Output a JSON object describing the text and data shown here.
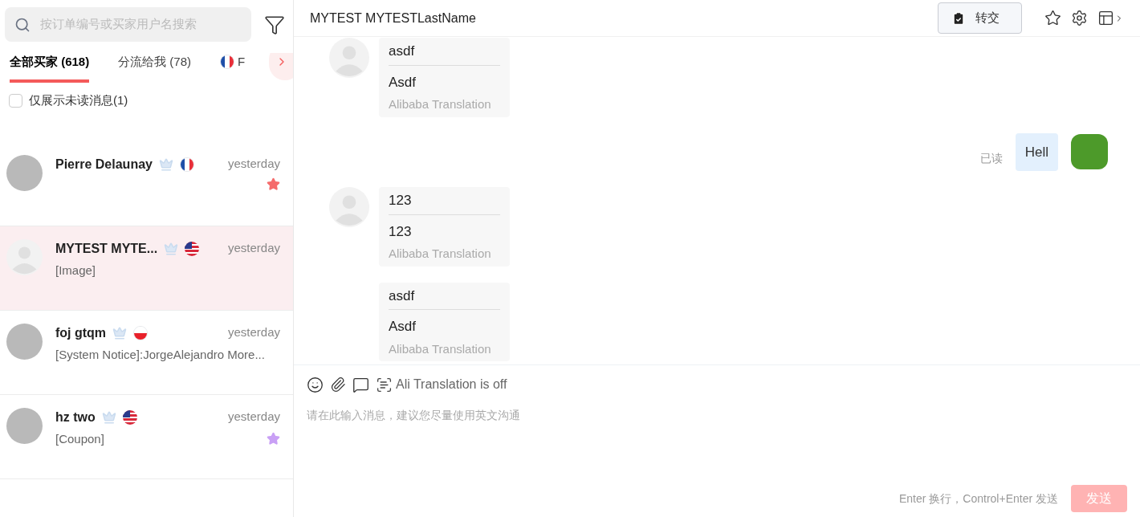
{
  "sidebar": {
    "search": {
      "placeholder": "按订单编号或买家用户名搜索"
    },
    "tabs": [
      {
        "label": "全部买家 (618)",
        "selected": true
      },
      {
        "label": "分流给我 (78)",
        "selected": false
      },
      {
        "label": "F",
        "selected": false,
        "flag": {
          "kind": "fr"
        }
      }
    ],
    "unread_filter": {
      "label": "仅展示未读消息(1)",
      "checked": false
    },
    "contacts": [
      {
        "name": "Pierre Delaunay",
        "has_photo": true,
        "flag": {
          "kind": "fr"
        },
        "time": "yesterday",
        "starred": true,
        "color": "#f56c6c",
        "selected": false
      },
      {
        "name": "MYTEST MYTE...",
        "has_photo": false,
        "flag": {
          "kind": "us"
        },
        "time": "yesterday",
        "preview": "[Image]",
        "starred": false,
        "selected": true
      },
      {
        "name": "foj gtqm",
        "has_photo": true,
        "flag": {
          "kind": "pl"
        },
        "time": "yesterday",
        "preview": "[System Notice]:JorgeAlejandro More...",
        "starred": false,
        "selected": false
      },
      {
        "name": "hz two",
        "has_photo": true,
        "flag": {
          "kind": "us"
        },
        "time": "yesterday",
        "preview": "[Coupon]",
        "starred": true,
        "color": "#c9a0f5",
        "selected": false
      }
    ]
  },
  "chat": {
    "title": "MYTEST MYTESTLastName",
    "transfer_button": "转交",
    "messages": [
      {
        "kind": "incoming",
        "original": "asdf",
        "translation": "Asdf",
        "source": "Alibaba Translation",
        "avatar": true
      },
      {
        "kind": "outgoing",
        "text": "Hell",
        "status": "已读"
      },
      {
        "kind": "incoming",
        "original": "123",
        "translation": "123",
        "source": "Alibaba Translation",
        "avatar": true
      },
      {
        "kind": "incoming",
        "original": "asdf",
        "translation": "Asdf",
        "source": "Alibaba Translation",
        "avatar": false
      }
    ],
    "composer": {
      "translation_status": "Ali Translation is off",
      "placeholder": "请在此输入消息，建议您尽量使用英文沟通",
      "hint": "Enter 换行，Control+Enter 发送",
      "send_button": "发送",
      "send_enabled": false
    }
  }
}
